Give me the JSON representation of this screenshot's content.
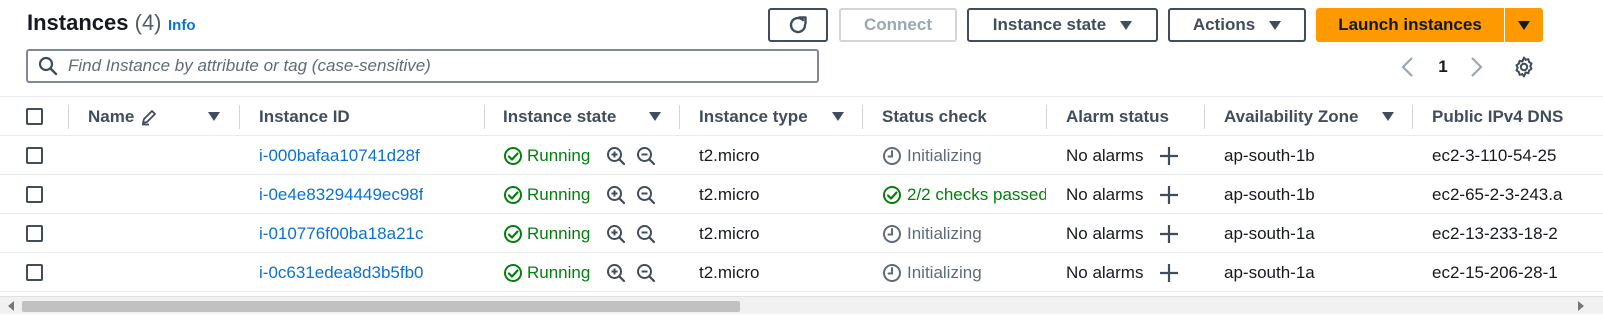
{
  "header": {
    "title": "Instances",
    "count": "(4)",
    "info": "Info"
  },
  "toolbar": {
    "connect": "Connect",
    "instance_state": "Instance state",
    "actions": "Actions",
    "launch": "Launch instances"
  },
  "search": {
    "placeholder": "Find Instance by attribute or tag (case-sensitive)",
    "value": ""
  },
  "pagination": {
    "current_page": "1"
  },
  "table": {
    "columns": [
      "Name",
      "Instance ID",
      "Instance state",
      "Instance type",
      "Status check",
      "Alarm status",
      "Availability Zone",
      "Public IPv4 DNS"
    ],
    "rows": [
      {
        "name": "",
        "id": "i-000bafaa10741d28f",
        "state": "Running",
        "type": "t2.micro",
        "status": "Initializing",
        "alarm": "No alarms",
        "az": "ap-south-1b",
        "dns": "ec2-3-110-54-25"
      },
      {
        "name": "",
        "id": "i-0e4e83294449ec98f",
        "state": "Running",
        "type": "t2.micro",
        "status": "2/2 checks passed",
        "alarm": "No alarms",
        "az": "ap-south-1b",
        "dns": "ec2-65-2-3-243.a"
      },
      {
        "name": "",
        "id": "i-010776f00ba18a21c",
        "state": "Running",
        "type": "t2.micro",
        "status": "Initializing",
        "alarm": "No alarms",
        "az": "ap-south-1a",
        "dns": "ec2-13-233-18-2"
      },
      {
        "name": "",
        "id": "i-0c631edea8d3b5fb0",
        "state": "Running",
        "type": "t2.micro",
        "status": "Initializing",
        "alarm": "No alarms",
        "az": "ap-south-1a",
        "dns": "ec2-15-206-28-1"
      }
    ]
  },
  "icons": {
    "refresh": "refresh-icon",
    "search": "search-icon",
    "edit": "pencil-icon",
    "running": "check-circle-icon",
    "passed": "check-circle-icon",
    "initializing": "clock-icon",
    "zoom_in": "zoom-in-icon",
    "zoom_out": "zoom-out-icon",
    "add_alarm": "plus-icon",
    "settings": "gear-icon"
  },
  "colors": {
    "primary": "#ff9900",
    "link": "#0972d3",
    "success": "#037f0c",
    "muted": "#5f6b7a"
  }
}
